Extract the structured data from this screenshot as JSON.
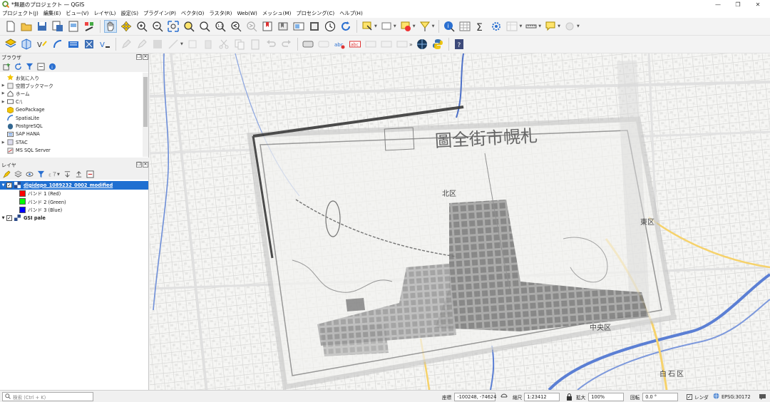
{
  "window": {
    "title": "*無題のプロジェクト — QGIS",
    "controls": [
      "—",
      "❐",
      "✕"
    ]
  },
  "menu": [
    "プロジェクト(J)",
    "編集(E)",
    "ビュー(V)",
    "レイヤ(L)",
    "設定(S)",
    "プラグイン(P)",
    "ベクタ(O)",
    "ラスタ(R)",
    "Web(W)",
    "メッシュ(M)",
    "プロセシング(C)",
    "ヘルプ(H)"
  ],
  "toolbar1": [
    "new-project",
    "open-project",
    "save-project",
    "save-as",
    "print-layout",
    "style-manager",
    "pan",
    "pan-to-selection",
    "zoom-in",
    "zoom-out",
    "zoom-full",
    "zoom-selection",
    "zoom-layer",
    "zoom-native",
    "zoom-last",
    "zoom-next",
    "new-bookmark",
    "show-bookmarks",
    "new-map-view",
    "new-3d-view",
    "temporal",
    "refresh",
    "select-feature",
    "deselect",
    "identify",
    "attribute-table",
    "statistics",
    "field-calc",
    "measure",
    "annotation",
    "tip"
  ],
  "toolbar2": [
    "data-source-manager",
    "new-gpkg",
    "new-shapefile",
    "new-spatialite",
    "new-virtual",
    "new-temp",
    "digitize",
    "toggle-edit",
    "save-edits",
    "add-point",
    "vertex",
    "delete",
    "cut",
    "copy",
    "paste",
    "undo",
    "redo",
    "label-pin",
    "label-show",
    "label-move",
    "label-rotate",
    "label-change",
    "more",
    "georef",
    "python",
    "help"
  ],
  "browser": {
    "title": "ブラウザ",
    "items": [
      {
        "label": "お気に入り",
        "icon": "star-icon",
        "expand": ""
      },
      {
        "label": "空間ブックマーク",
        "icon": "bookmark-icon",
        "expand": "▶"
      },
      {
        "label": "ホーム",
        "icon": "home-icon",
        "expand": "▶"
      },
      {
        "label": "C:\\",
        "icon": "drive-icon",
        "expand": "▶"
      },
      {
        "label": "GeoPackage",
        "icon": "geopackage-icon",
        "expand": ""
      },
      {
        "label": "SpatiaLite",
        "icon": "spatialite-icon",
        "expand": ""
      },
      {
        "label": "PostgreSQL",
        "icon": "postgresql-icon",
        "expand": ""
      },
      {
        "label": "SAP HANA",
        "icon": "saphana-icon",
        "expand": ""
      },
      {
        "label": "STAC",
        "icon": "stac-icon",
        "expand": "▶"
      },
      {
        "label": "MS SQL Server",
        "icon": "mssql-icon",
        "expand": ""
      }
    ]
  },
  "layers": {
    "title": "レイヤ",
    "items": [
      {
        "label": "digidepo_1089232_0002_modified",
        "type": "raster",
        "checked": true,
        "selected": true
      },
      {
        "label": "バンド 1 (Red)",
        "type": "band",
        "color": "#ff0000"
      },
      {
        "label": "バンド 2 (Green)",
        "type": "band",
        "color": "#00ff00"
      },
      {
        "label": "バンド 3 (Blue)",
        "type": "band",
        "color": "#0000ff"
      },
      {
        "label": "GSI pale",
        "type": "raster",
        "checked": true,
        "selected": false
      }
    ]
  },
  "map": {
    "old_map_title": "圖全街市幌札",
    "district_labels": [
      "北区",
      "東区",
      "中央区",
      "白石区"
    ]
  },
  "status": {
    "search_placeholder": "検索 (Ctrl + K)",
    "coord_label": "座標",
    "coord_value": "-100248, -74624",
    "scale_label": "縮尺",
    "scale_value": "1:23412",
    "magnifier_label": "拡大",
    "magnifier_value": "100%",
    "rotation_label": "回転",
    "rotation_value": "0.0 °",
    "render_label": "レンダ",
    "crs": "EPSG:30172"
  }
}
